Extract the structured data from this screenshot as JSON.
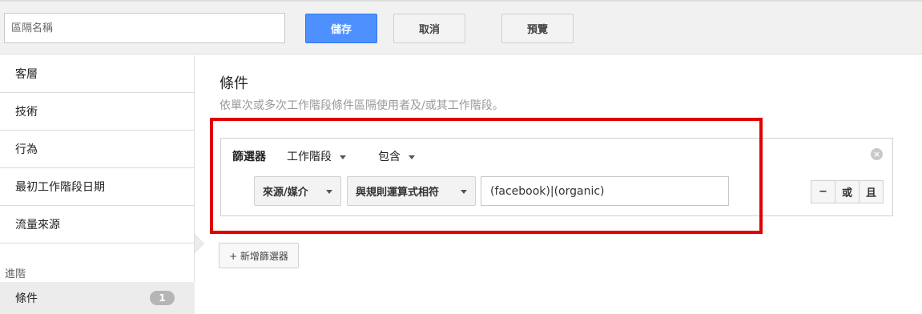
{
  "header": {
    "name_placeholder": "區隔名稱",
    "save_label": "儲存",
    "cancel_label": "取消",
    "preview_label": "預覽"
  },
  "sidebar": {
    "items": [
      {
        "label": "客層"
      },
      {
        "label": "技術"
      },
      {
        "label": "行為"
      },
      {
        "label": "最初工作階段日期"
      },
      {
        "label": "流量來源"
      }
    ],
    "section_label": "進階",
    "active_item": {
      "label": "條件",
      "badge": "1"
    }
  },
  "main": {
    "title": "條件",
    "subtitle": "依單次或多次工作階段條件區隔使用者及/或其工作階段。",
    "filter": {
      "label": "篩選器",
      "scope": "工作階段",
      "mode": "包含",
      "dimension": "來源/媒介",
      "operator": "與規則運算式相符",
      "value": "(facebook)|(organic)",
      "ops": [
        "−",
        "或",
        "且"
      ]
    },
    "add_filter_label": "+ 新增篩選器"
  },
  "colors": {
    "accent": "#4d90fe",
    "highlight": "#e00000",
    "badge": "#b5b5b5"
  }
}
